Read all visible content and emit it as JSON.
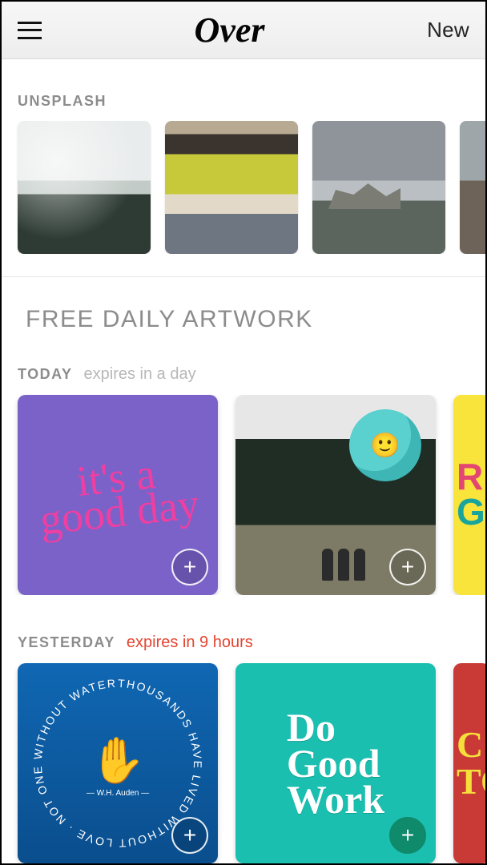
{
  "header": {
    "app_name": "Over",
    "new_label": "New"
  },
  "unsplash": {
    "label": "UNSPLASH",
    "images": [
      {
        "alt": "misty-forest"
      },
      {
        "alt": "folded-blankets"
      },
      {
        "alt": "beached-shipwreck"
      },
      {
        "alt": "rocky-coast"
      }
    ]
  },
  "artwork": {
    "title": "FREE DAILY ARTWORK",
    "rows": [
      {
        "day_label": "TODAY",
        "expiry_text": "expires in a day",
        "expiry_urgent": false,
        "cards": [
          {
            "id": "its-a-good-day",
            "text": "it's a\ngood day"
          },
          {
            "id": "earth-photo",
            "text": ""
          },
          {
            "id": "yellow-r-g",
            "text": "R\nG"
          }
        ]
      },
      {
        "day_label": "YESTERDAY",
        "expiry_text": "expires in 9 hours",
        "expiry_urgent": true,
        "cards": [
          {
            "id": "without-water",
            "text": "THOUSANDS HAVE LIVED WITHOUT LOVE · NOT ONE WITHOUT WATER",
            "attribution": "— W.H. Auden —"
          },
          {
            "id": "do-good-work",
            "text": "Do\nGood\nWork"
          },
          {
            "id": "red-c-to",
            "text": "C\nTO"
          }
        ]
      }
    ]
  },
  "icons": {
    "plus": "+"
  }
}
